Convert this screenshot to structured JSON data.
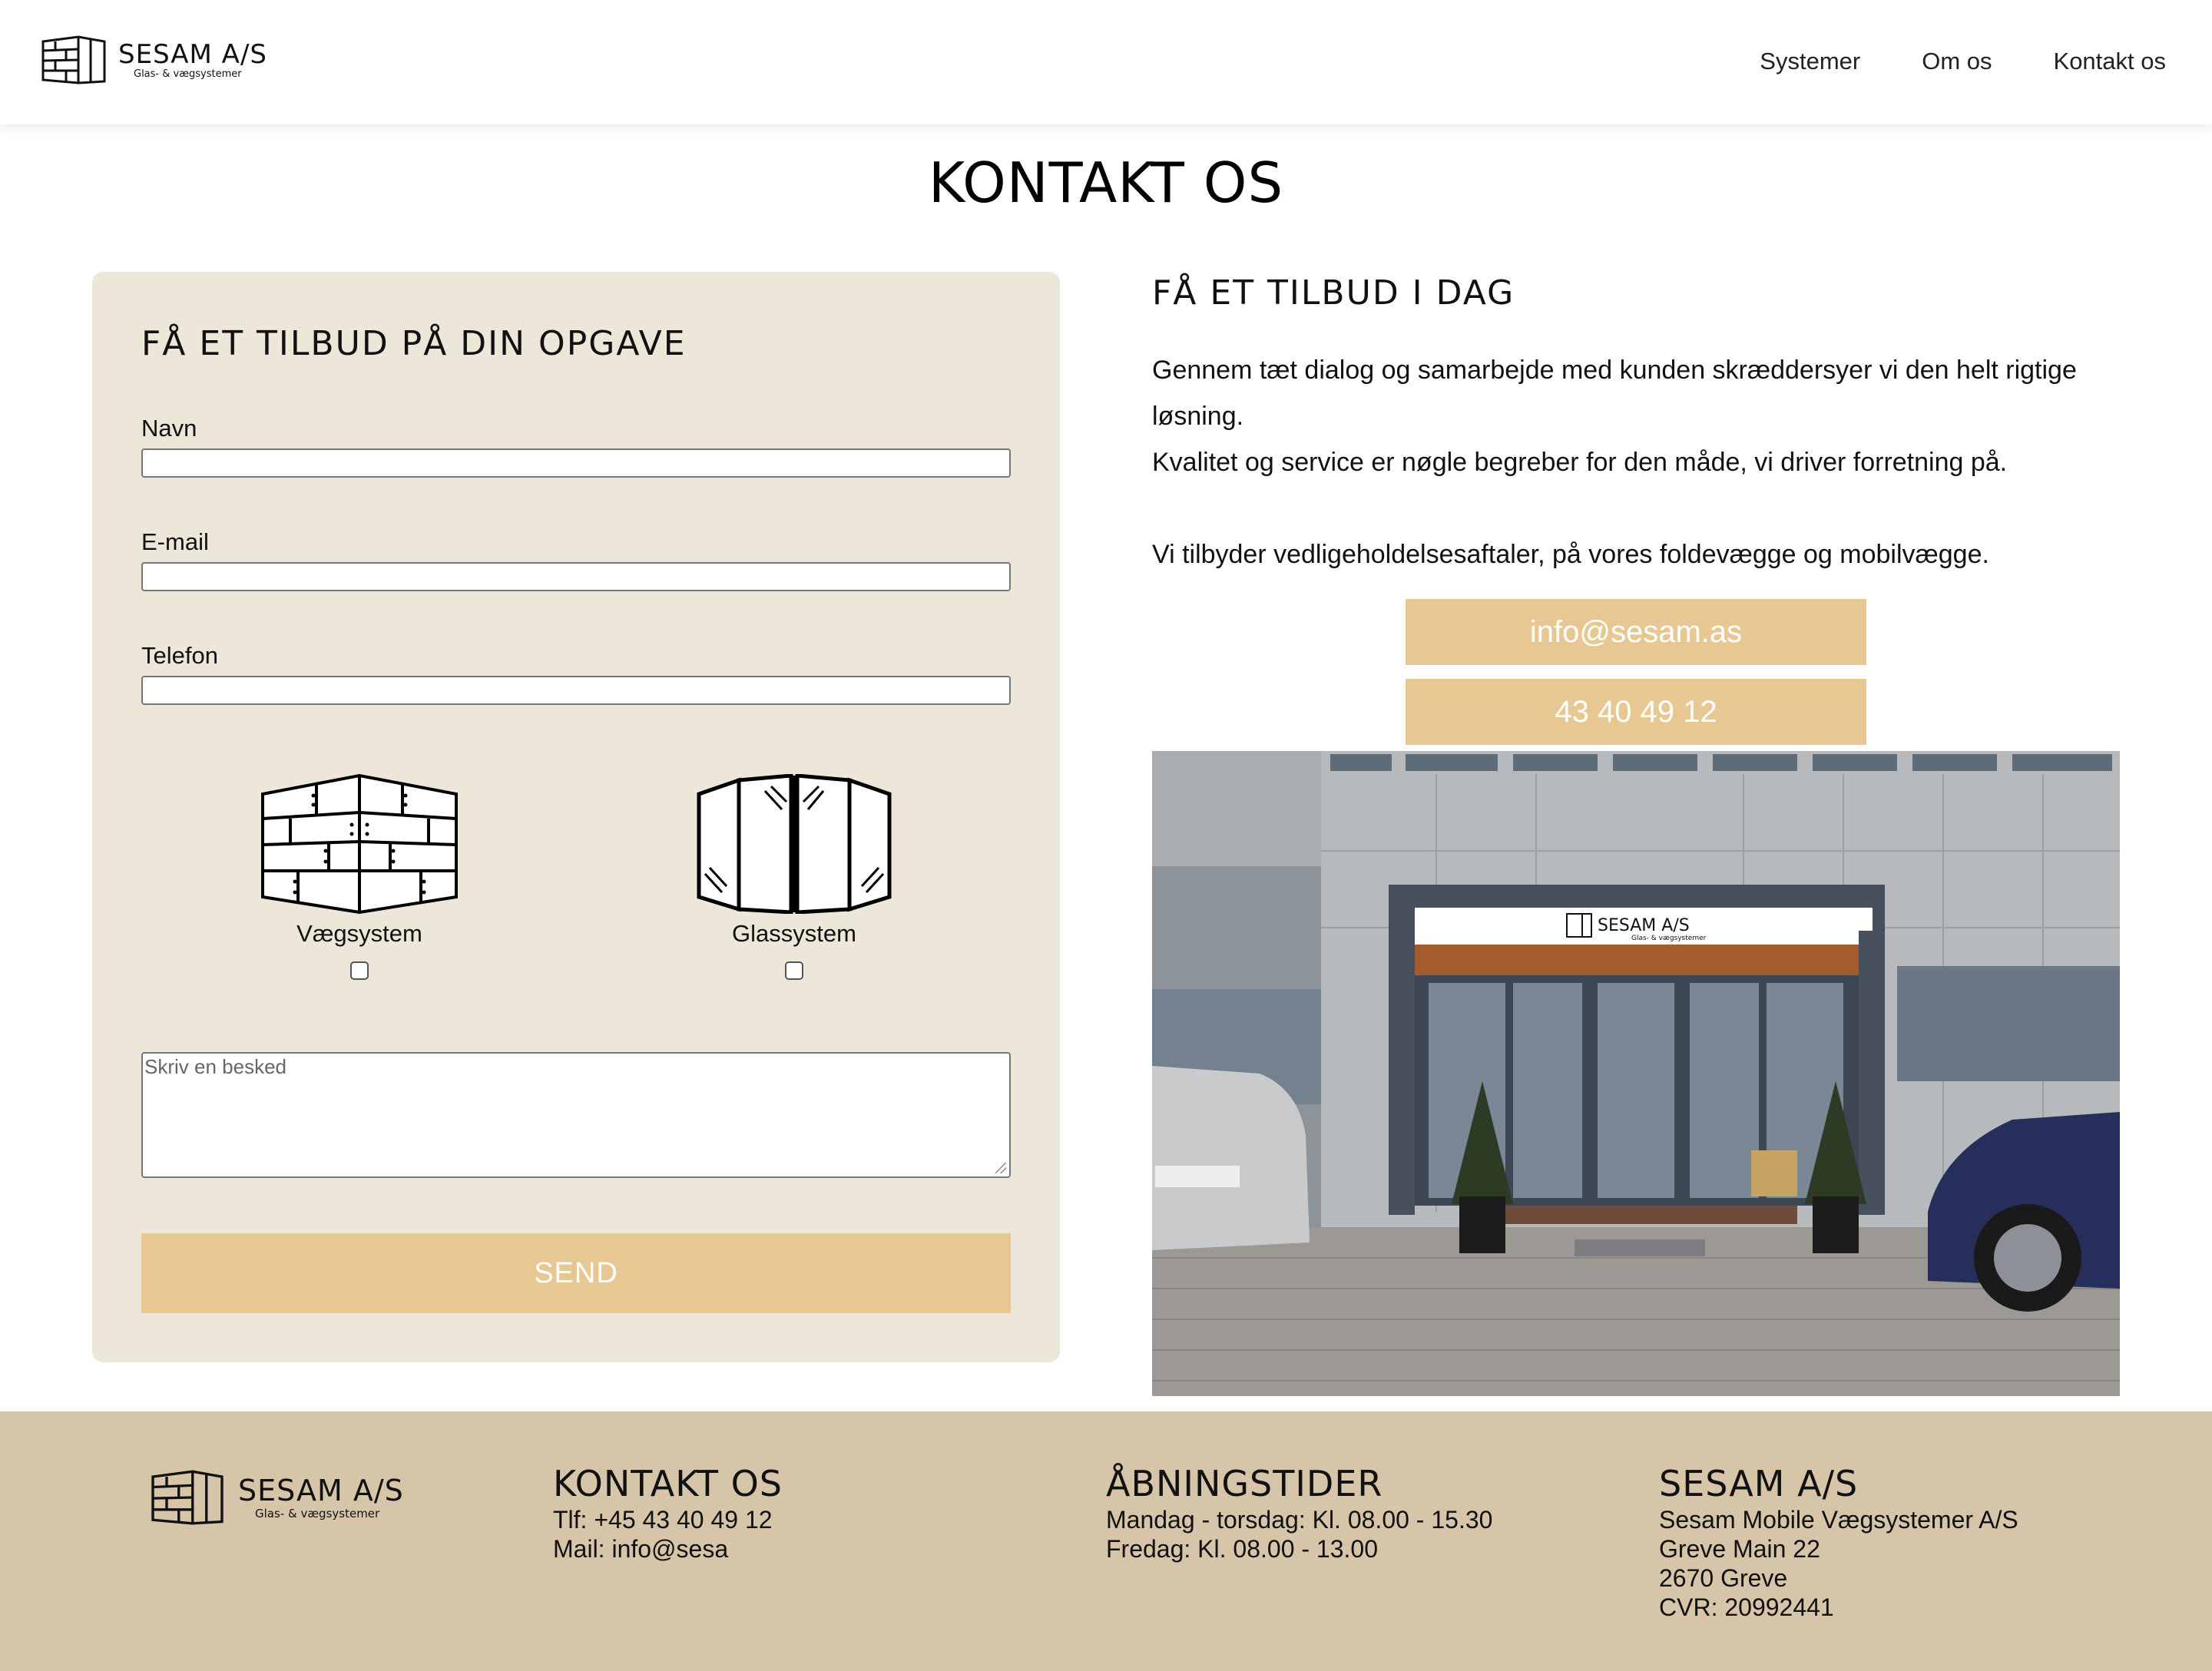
{
  "brand": {
    "name": "SESAM A/S",
    "tagline": "Glas- & vægsystemer"
  },
  "nav": {
    "items": [
      "Systemer",
      "Om os",
      "Kontakt os"
    ]
  },
  "page": {
    "title": "KONTAKT OS"
  },
  "form": {
    "heading": "FÅ ET TILBUD PÅ DIN OPGAVE",
    "name_label": "Navn",
    "email_label": "E-mail",
    "phone_label": "Telefon",
    "systems": [
      {
        "label": "Vægsystem",
        "checked": false,
        "icon": "wall-system-icon"
      },
      {
        "label": "Glassystem",
        "checked": false,
        "icon": "glass-system-icon"
      }
    ],
    "message_placeholder": "Skriv en besked",
    "send_label": "SEND"
  },
  "offer": {
    "heading": "FÅ ET TILBUD I DAG",
    "paragraphs": [
      "Gennem tæt dialog og samarbejde med kunden skræddersyer vi den helt rigtige løsning.",
      "Kvalitet og service er nøgle begreber for den måde, vi driver forretning på.",
      "Vi tilbyder vedligeholdelsesaftaler, på vores foldevægge og mobilvægge."
    ],
    "email_button": "info@sesam.as",
    "phone_button": "43 40 49 12"
  },
  "photo": {
    "sign_name": "SESAM A/S",
    "sign_tagline": "Glas- & vægsystemer"
  },
  "footer": {
    "contact": {
      "title": "KONTAKT OS",
      "lines": [
        "Tlf: +45 43 40 49 12",
        "Mail: info@sesa"
      ]
    },
    "hours": {
      "title": "ÅBNINGSTIDER",
      "lines": [
        "Mandag - torsdag: Kl. 08.00 - 15.30",
        "Fredag: Kl. 08.00 - 13.00"
      ]
    },
    "company": {
      "title": "SESAM A/S",
      "lines": [
        "Sesam Mobile Vægsystemer A/S",
        "Greve Main 22",
        "2670 Greve",
        "CVR: 20992441"
      ]
    }
  },
  "colors": {
    "accent": "#e7c893",
    "card": "#ede7da",
    "footer": "#d6c5a9"
  }
}
